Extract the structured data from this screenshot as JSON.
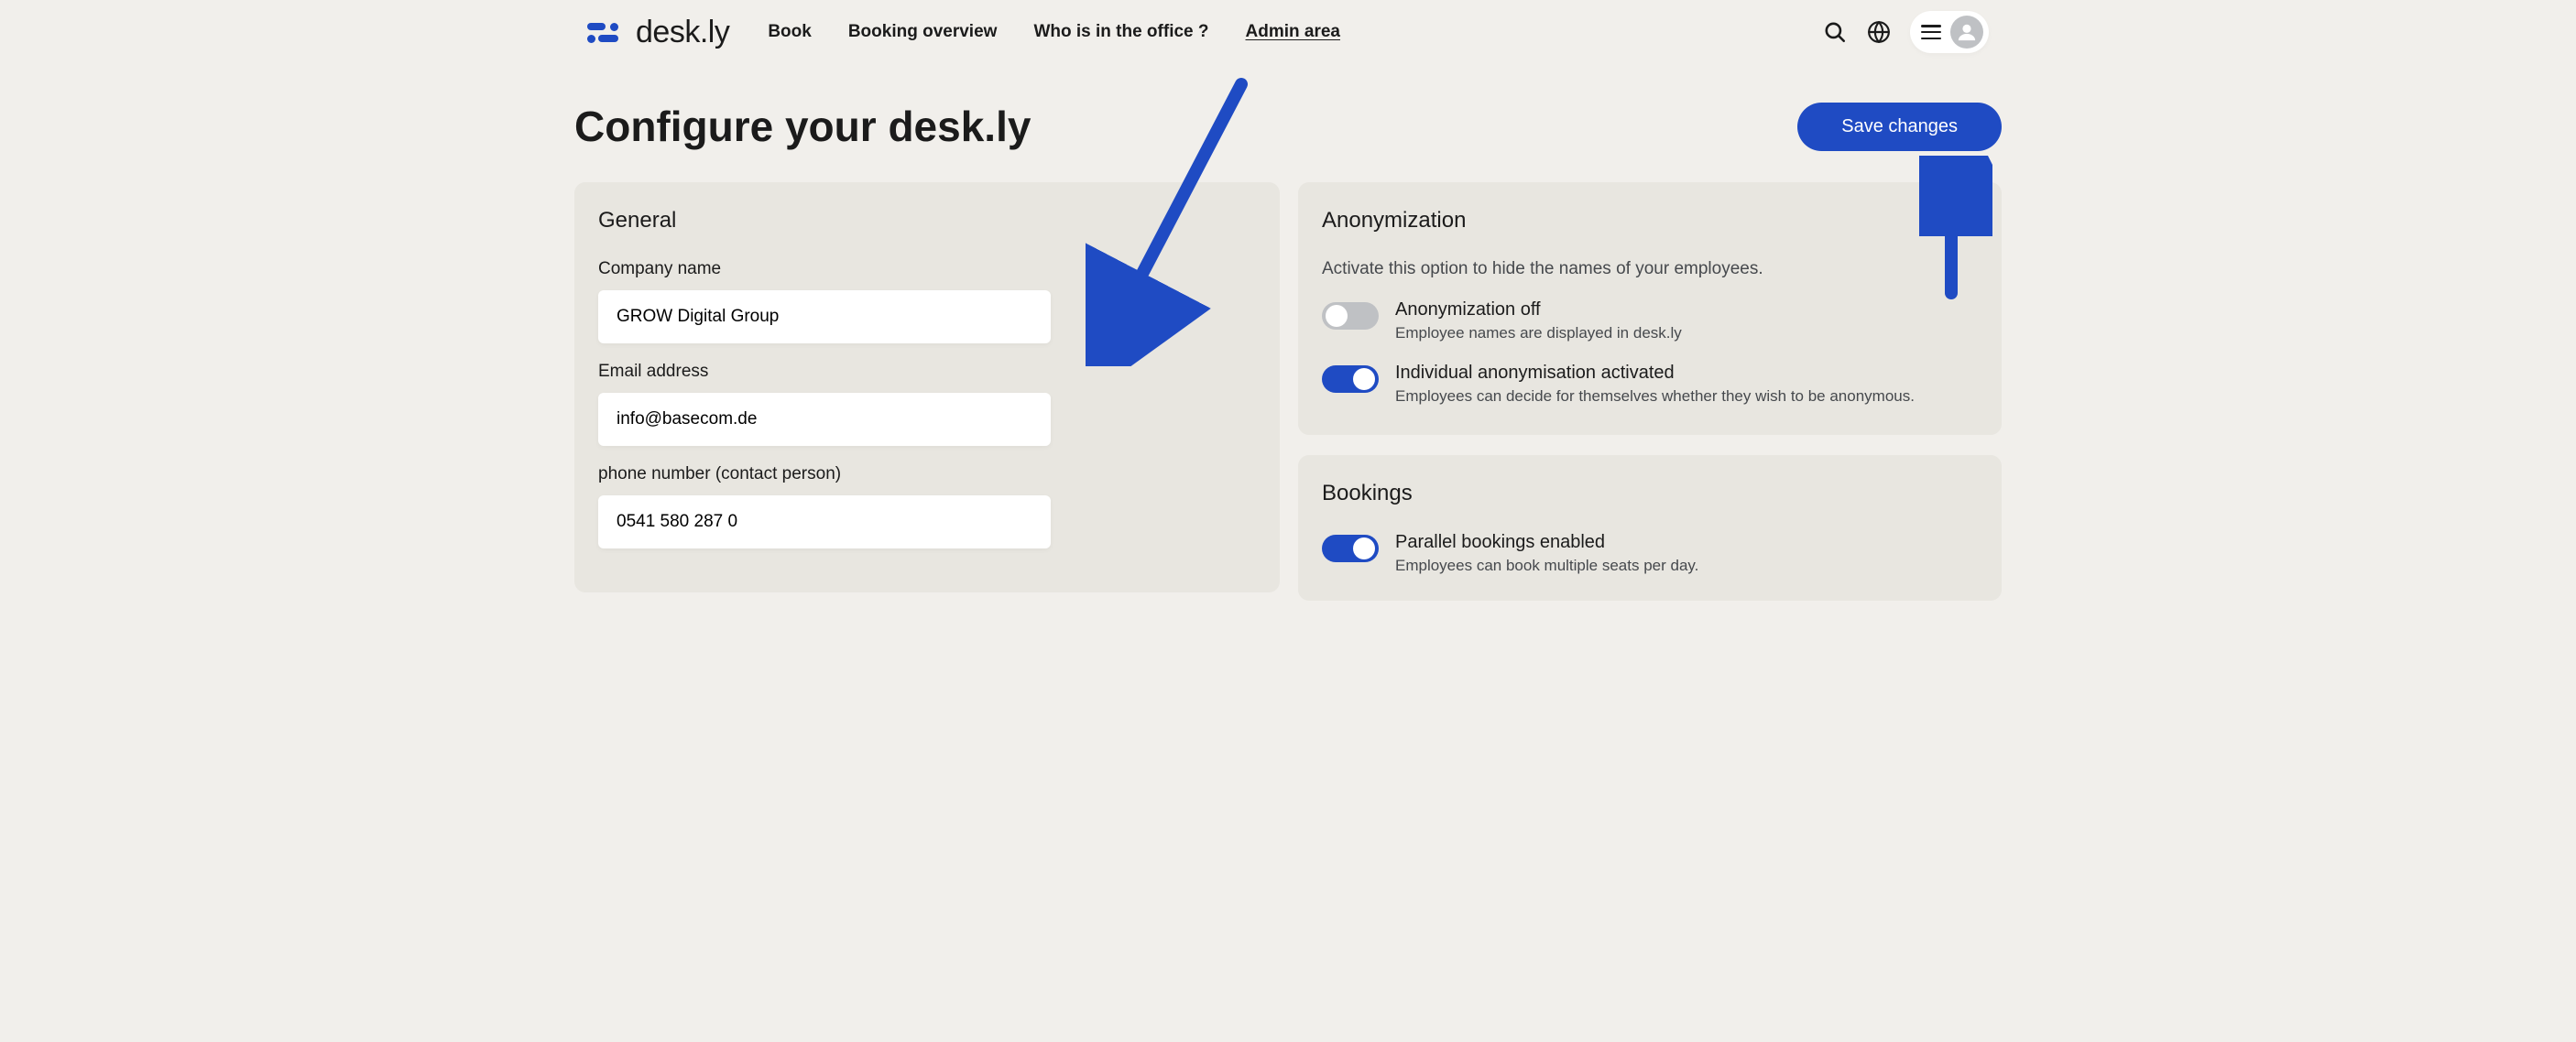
{
  "logo": {
    "text": "desk.ly"
  },
  "nav": {
    "book": "Book",
    "overview": "Booking overview",
    "who": "Who is in the office ?",
    "admin": "Admin area"
  },
  "page": {
    "title": "Configure your desk.ly",
    "save_button": "Save changes"
  },
  "general": {
    "title": "General",
    "company_label": "Company name",
    "company_value": "GROW Digital Group",
    "email_label": "Email address",
    "email_value": "info@basecom.de",
    "phone_label": "phone number (contact person)",
    "phone_value": "0541 580 287 0"
  },
  "anonymization": {
    "title": "Anonymization",
    "desc": "Activate this option to hide the names of your employees.",
    "toggle1": {
      "on": false,
      "title": "Anonymization off",
      "desc": "Employee names are displayed in desk.ly"
    },
    "toggle2": {
      "on": true,
      "title": "Individual anonymisation activated",
      "desc": "Employees can decide for themselves whether they wish to be anonymous."
    }
  },
  "bookings": {
    "title": "Bookings",
    "toggle1": {
      "on": true,
      "title": "Parallel bookings enabled",
      "desc": "Employees can book multiple seats per day."
    }
  }
}
